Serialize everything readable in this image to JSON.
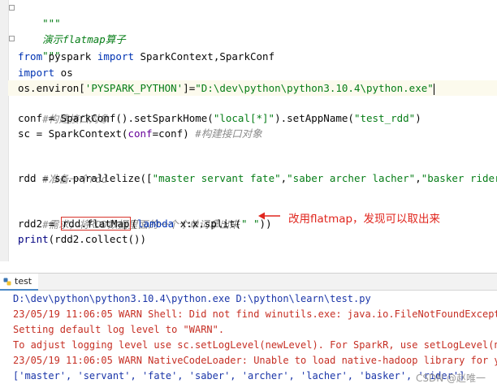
{
  "editor": {
    "lines": {
      "l1": "\"\"\"",
      "l2": "演示flatmap算子",
      "l3": "\"\"\"",
      "l4_kw1": "from",
      "l4_mod": " pyspark ",
      "l4_kw2": "import",
      "l4_rest": " SparkContext,SparkConf",
      "l5_kw": "import",
      "l5_rest": " os",
      "l6_a": "os.environ[",
      "l6_key": "'PYSPARK_PYTHON'",
      "l6_b": "]=",
      "l6_val": "\"D:\\dev\\python\\python3.10.4\\python.exe\"",
      "l7": "#构建接口对象",
      "l8_a": "conf = SparkConf().setSparkHome(",
      "l8_s1": "\"local[*]\"",
      "l8_b": ").setAppName(",
      "l8_s2": "\"test_rdd\"",
      "l8_c": ")",
      "l9_a": "sc = SparkContext(",
      "l9_named": "conf",
      "l9_b": "=conf) ",
      "l9_cmt": "#构建接口对象",
      "l10": "#准备一个rdd",
      "l11_a": "rdd = sc.parallelize([",
      "l11_s1": "\"master servant fate\"",
      "l11_c1": ",",
      "l11_s2": "\"saber archer lacher\"",
      "l11_c2": ",",
      "l11_s3": "\"basker rider\"",
      "l11_b": "])",
      "l12": "#需求，将RDD数据里面的一个个单词拿出来",
      "l13_a": "rdd2 = ",
      "l13_boxed": "rdd.flatMap",
      "l13_b": "(",
      "l13_kw": "lambda",
      "l13_c": " x:x.split(",
      "l13_s": "\" \"",
      "l13_d": "))",
      "l14_fn": "print",
      "l14_rest": "(rdd2.collect())"
    }
  },
  "annotation": {
    "text": "改用flatmap，发现可以取出来",
    "color": "#e0261e"
  },
  "run": {
    "tab_label": "test",
    "console": [
      "D:\\dev\\python\\python3.10.4\\python.exe D:\\python\\learn\\test.py",
      "23/05/19 11:06:05 WARN Shell: Did not find winutils.exe: java.io.FileNotFoundException",
      "Setting default log level to \"WARN\".",
      "To adjust logging level use sc.setLogLevel(newLevel). For SparkR, use setLogLevel(newLe",
      "23/05/19 11:06:05 WARN NativeCodeLoader: Unable to load native-hadoop library for your",
      "['master', 'servant', 'fate', 'saber', 'archer', 'lacher', 'basker', 'rider']"
    ]
  },
  "watermark": "CSDN @赵唯一",
  "colors": {
    "keyword": "#0033b3",
    "string": "#067d17",
    "comment": "#8c8c8c",
    "error_text": "#c62f24",
    "stdout_text": "#1a35a8",
    "highlight_box": "#d9342b"
  }
}
